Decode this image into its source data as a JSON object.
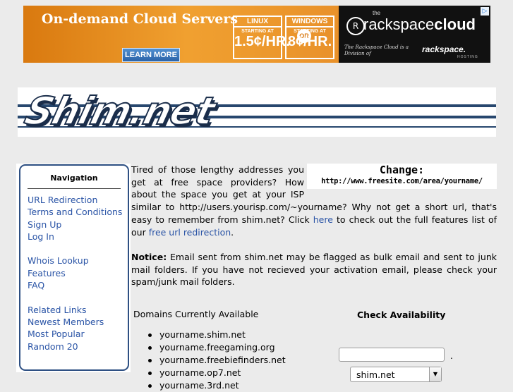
{
  "ad": {
    "headline": "On-demand Cloud Servers",
    "learn_more": "LEARN MORE",
    "linux": {
      "os": "LINUX",
      "starting": "STARTING AT",
      "price": "1.5¢/HR."
    },
    "or": "OR",
    "windows": {
      "os": "WINDOWS",
      "starting": "STARTING AT",
      "price": "8¢/HR."
    },
    "brand_the": "the",
    "brand_name": "rackspace",
    "brand_suffix": "cloud",
    "division_text": "The Rackspace Cloud is a Division of",
    "division_brand": "rackspace.",
    "hosting": "HOSTING",
    "info_glyph": "▷",
    "colors": {
      "orange": "#e8902a",
      "dark": "#111111"
    }
  },
  "logo": {
    "text": "Shim.net",
    "color": "#27476e"
  },
  "nav": {
    "title": "Navigation",
    "group1": [
      "URL Redirection",
      "Terms and Conditions",
      "Sign Up",
      "Log In"
    ],
    "group2": [
      "Whois Lookup",
      "Features",
      "FAQ"
    ],
    "group3": [
      "Related Links",
      "Newest Members",
      "Most Popular",
      "Random 20"
    ]
  },
  "change": {
    "title": "Change:",
    "url": "http://www.freesite.com/area/yourname/"
  },
  "intro": {
    "text_before_here": "Tired of those lengthy addresses you get at free space providers? How about the space you get at your ISP similar to http://users.yourisp.com/~yourname? Why not get a short url, that's easy to remember from shim.net? Click ",
    "here_link": "here",
    "text_after_here": " to check out the full features list of our ",
    "free_url_link": "free url redirection",
    "end": "."
  },
  "notice": {
    "label": "Notice:",
    "text": " Email sent from shim.net may be flagged as bulk email and sent to junk mail folders. If you have not recieved your activation email, please check your spam/junk mail folders."
  },
  "domains": {
    "title": "Domains Currently Available",
    "items": [
      "yourname.shim.net",
      "yourname.freegaming.org",
      "yourname.freebiefinders.net",
      "yourname.op7.net",
      "yourname.3rd.net"
    ]
  },
  "check": {
    "title": "Check Availability",
    "input_value": "",
    "dot": ".",
    "selected_domain": "shim.net",
    "arrow": "▼"
  },
  "colors": {
    "link": "#2a54a6",
    "nav_border": "#2d4f82",
    "background": "#ebebeb"
  }
}
